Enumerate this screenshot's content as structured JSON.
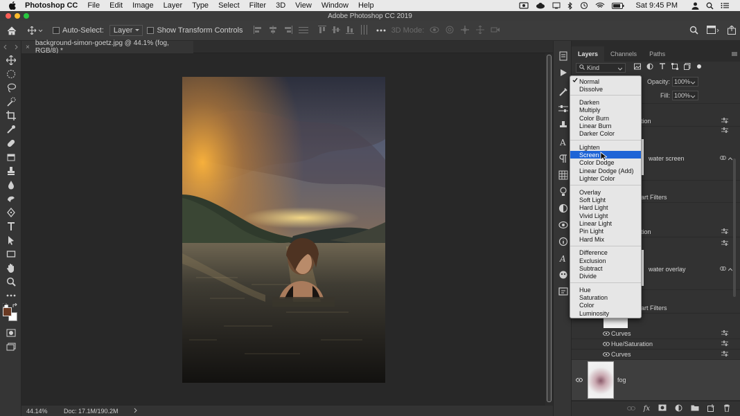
{
  "menubar": {
    "app": "Photoshop CC",
    "items": [
      "File",
      "Edit",
      "Image",
      "Layer",
      "Type",
      "Select",
      "Filter",
      "3D",
      "View",
      "Window",
      "Help"
    ],
    "clock": "Sat 9:45 PM"
  },
  "window": {
    "title": "Adobe Photoshop CC 2019"
  },
  "options": {
    "auto_select_label": "Auto-Select:",
    "auto_select_value": "Layer",
    "transform_label": "Show Transform Controls",
    "mode_3d_label": "3D Mode:"
  },
  "document": {
    "tab_title": "background-simon-goetz.jpg @ 44.1% (fog, RGB/8) *",
    "close_glyph": "×",
    "zoom": "44.14%",
    "doc_size": "Doc: 17.1M/190.2M"
  },
  "panel": {
    "tabs": [
      "Layers",
      "Channels",
      "Paths"
    ],
    "filter_value": "Kind",
    "opacity_label": "Opacity:",
    "opacity_value": "100%",
    "fill_label": "Fill:",
    "fill_value": "100%",
    "partial": {
      "a": "tion",
      "b": "art Filters",
      "c": "tion",
      "d": "art Filters"
    },
    "layers": {
      "water_screen": "water screen",
      "water_overlay": "water overlay",
      "curves_1": "Curves",
      "hue_sat": "Hue/Saturation",
      "curves_2": "Curves",
      "fog": "fog"
    }
  },
  "blend_modes": {
    "selected": "Screen",
    "checked": "Normal",
    "groups": [
      [
        "Normal",
        "Dissolve"
      ],
      [
        "Darken",
        "Multiply",
        "Color Burn",
        "Linear Burn",
        "Darker Color"
      ],
      [
        "Lighten",
        "Screen",
        "Color Dodge",
        "Linear Dodge (Add)",
        "Lighter Color"
      ],
      [
        "Overlay",
        "Soft Light",
        "Hard Light",
        "Vivid Light",
        "Linear Light",
        "Pin Light",
        "Hard Mix"
      ],
      [
        "Difference",
        "Exclusion",
        "Subtract",
        "Divide"
      ],
      [
        "Hue",
        "Saturation",
        "Color",
        "Luminosity"
      ]
    ]
  },
  "colors": {
    "selection": "#1e64d6",
    "foreground_swatch": "#6b3a23",
    "background_swatch": "#ffffff"
  }
}
